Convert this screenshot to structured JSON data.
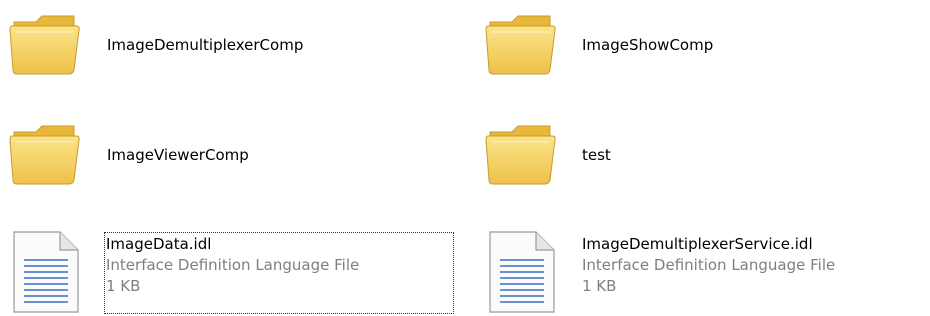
{
  "items": [
    {
      "type": "folder",
      "name": "ImageDemultiplexerComp"
    },
    {
      "type": "folder",
      "name": "ImageShowComp"
    },
    {
      "type": "folder",
      "name": "ImageViewerComp"
    },
    {
      "type": "folder",
      "name": "test"
    },
    {
      "type": "file",
      "name": "ImageData.idl",
      "kind": "Interface Definition Language File",
      "size": "1 KB",
      "focused": true
    },
    {
      "type": "file",
      "name": "ImageDemultiplexerService.idl",
      "kind": "Interface Definition Language File",
      "size": "1 KB",
      "focused": false
    }
  ],
  "colors": {
    "folder_body": "#f6d466",
    "folder_tab": "#e9b73a",
    "folder_edge": "#c99a2a",
    "doc_lines": "#3a6fc4",
    "secondary_text": "#7f7f7f"
  }
}
